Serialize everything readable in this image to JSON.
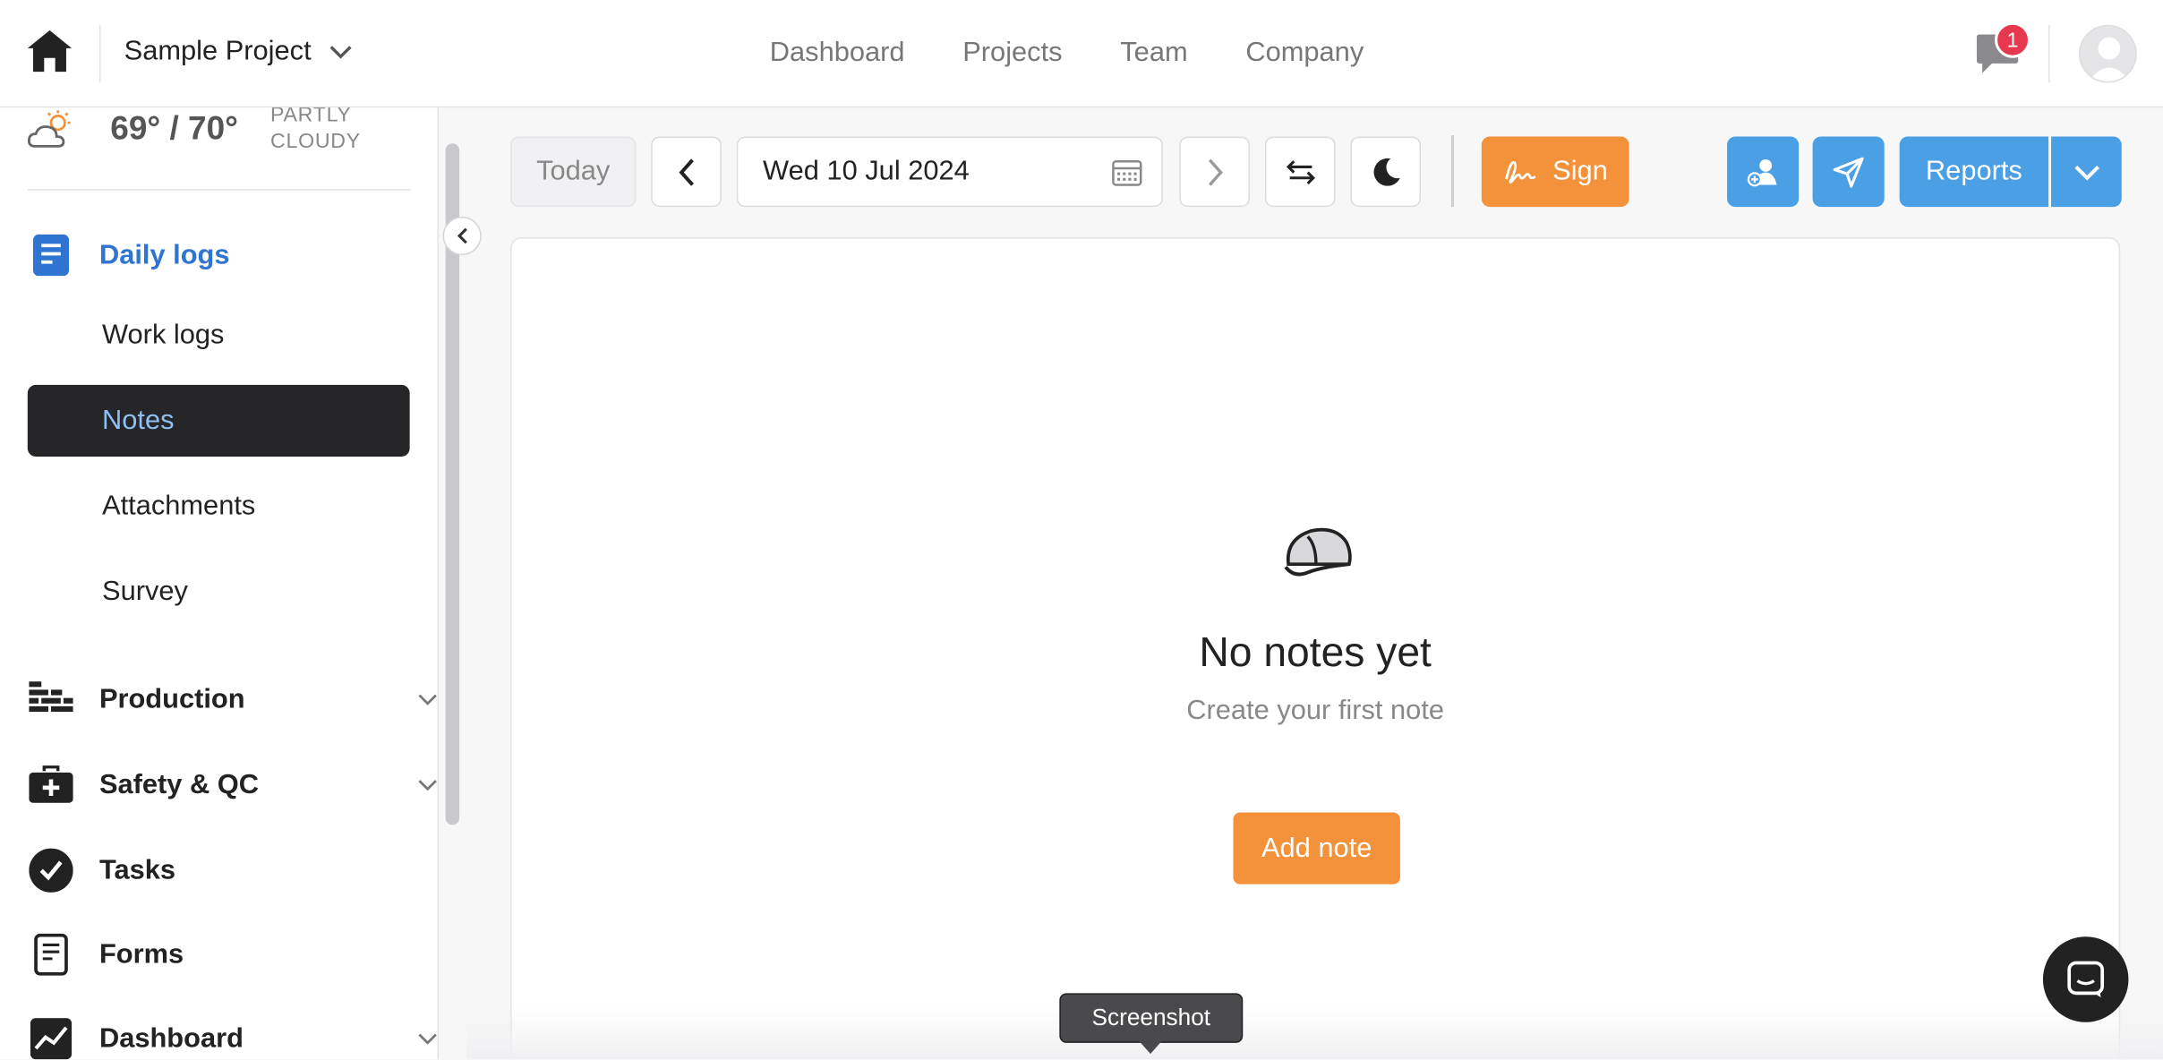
{
  "header": {
    "project_name": "Sample Project",
    "nav": [
      "Dashboard",
      "Projects",
      "Team",
      "Company"
    ],
    "notification_count": "1"
  },
  "sidebar": {
    "weather": {
      "temp": "69° / 70°",
      "condition_line1": "PARTLY",
      "condition_line2": "CLOUDY"
    },
    "daily_logs": {
      "label": "Daily logs",
      "items": [
        "Work logs",
        "Notes",
        "Attachments",
        "Survey"
      ],
      "selected": "Notes"
    },
    "sections": [
      "Production",
      "Safety & QC",
      "Tasks",
      "Forms",
      "Dashboard"
    ]
  },
  "toolbar": {
    "today_label": "Today",
    "date_value": "Wed 10 Jul 2024",
    "sign_label": "Sign",
    "reports_label": "Reports"
  },
  "main": {
    "empty_title": "No notes yet",
    "empty_subtitle": "Create your first note",
    "add_label": "Add note"
  },
  "tooltip": {
    "label": "Screenshot"
  },
  "colors": {
    "accent_orange": "#f4913b",
    "accent_blue": "#4a9fe5",
    "active_blue": "#2f74d0",
    "selected_bg": "#262628",
    "badge_red": "#e8384f"
  }
}
